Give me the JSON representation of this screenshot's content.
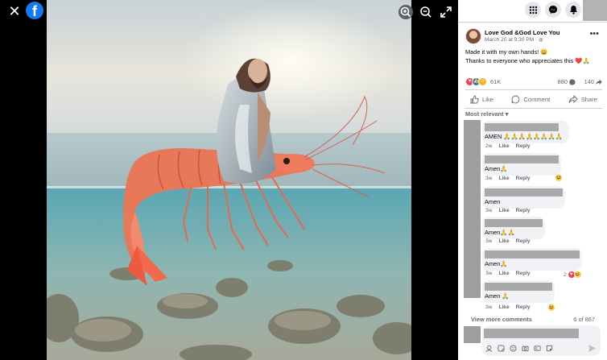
{
  "viewer": {
    "close_icon": "close-icon",
    "logo": "f",
    "tools": [
      "zoom-in-icon",
      "zoom-out-icon",
      "fullscreen-icon"
    ]
  },
  "topbar": {
    "icons": [
      "apps-grid-icon",
      "messenger-icon",
      "notifications-bell-icon"
    ]
  },
  "post": {
    "author": "Love God &God Love You",
    "time": "March 20 at 9:30 PM · ",
    "text_line1": "Made it with my own hands! 😀",
    "text_line2": "Thanks to everyone who appreciates this ❤️🙏",
    "reaction_count": "61K",
    "comment_count": "880",
    "share_count": "140"
  },
  "actions": {
    "like": "Like",
    "comment": "Comment",
    "share": "Share"
  },
  "sort_label": "Most relevant ▾",
  "comments": [
    {
      "text": "AMEN 🙏🙏🙏🙏🙏🙏🙏🙏",
      "time": "2w"
    },
    {
      "text": "Amen🙏",
      "time": "3w"
    },
    {
      "text": "Amen",
      "time": "3w"
    },
    {
      "text": "Amen🙏🙏",
      "time": "3w"
    },
    {
      "text": "Amen🙏",
      "time": "3w",
      "reactions": "2"
    },
    {
      "text": "Amen 🙏",
      "time": "3w"
    }
  ],
  "comment_actions": {
    "like": "Like",
    "reply": "Reply"
  },
  "view_more": "View more comments",
  "page_count": "6 of 867",
  "colors": {
    "brand": "#1877f2",
    "panel_bg": "#ffffff",
    "bubble": "#f0f2f5",
    "redaction": "#a9a9a9"
  }
}
